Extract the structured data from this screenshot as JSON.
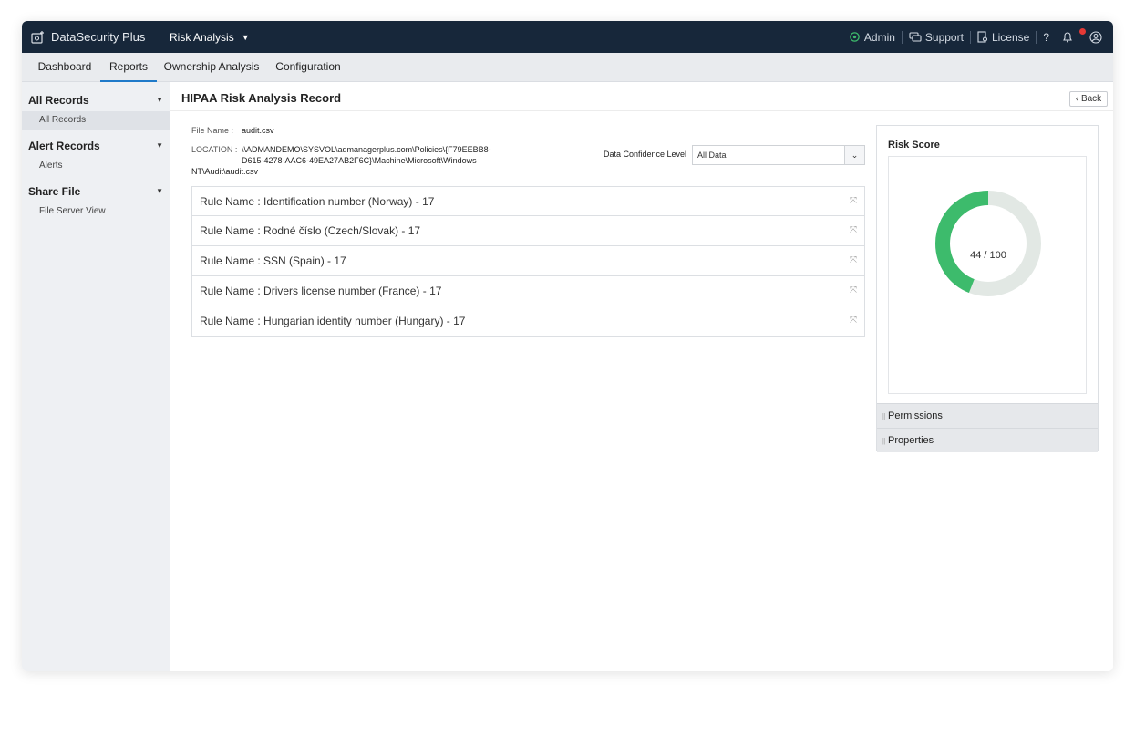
{
  "app": {
    "brand": "DataSecurity Plus",
    "module": "Risk Analysis",
    "top_links": {
      "admin": "Admin",
      "support": "Support",
      "license": "License",
      "help": "?"
    }
  },
  "nav": {
    "tabs": [
      "Dashboard",
      "Reports",
      "Ownership Analysis",
      "Configuration"
    ],
    "active": "Reports"
  },
  "sidebar": {
    "sections": [
      {
        "title": "All Records",
        "items": [
          "All Records"
        ]
      },
      {
        "title": "Alert Records",
        "items": [
          "Alerts"
        ]
      },
      {
        "title": "Share File",
        "items": [
          "File Server View"
        ]
      }
    ],
    "selected": "All Records"
  },
  "page": {
    "title": "HIPAA Risk Analysis Record",
    "back": "Back",
    "file_name_label": "File Name :",
    "file_name": "audit.csv",
    "location_label": "LOCATION :",
    "location_lines": [
      "\\\\ADMANDEMO\\SYSVOL\\admanagerplus.com\\Policies\\{F79EEBB8-",
      "D615-4278-AAC6-49EA27AB2F6C}\\Machine\\Microsoft\\Windows",
      "NT\\Audit\\audit.csv"
    ],
    "data_confidence_label": "Data Confidence Level",
    "data_confidence_value": "All Data"
  },
  "rules": [
    "Rule Name : Identification number (Norway) - 17",
    "Rule Name : Rodné číslo (Czech/Slovak) - 17",
    "Rule Name : SSN (Spain) - 17",
    "Rule Name : Drivers license number (France) - 17",
    "Rule Name : Hungarian identity number (Hungary) - 17"
  ],
  "risk": {
    "title": "Risk Score",
    "score": 44,
    "max": 100,
    "score_text": "44  /  100",
    "fill_color": "#3dbb6c",
    "track_color": "#e2e8e4"
  },
  "accordions": [
    "Permissions",
    "Properties"
  ]
}
